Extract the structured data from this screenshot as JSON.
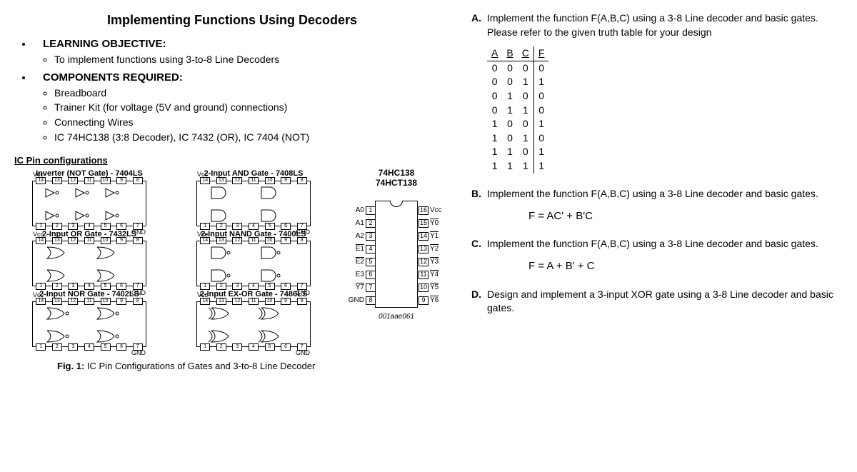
{
  "title": "Implementing Functions Using Decoders",
  "learning": {
    "header": "LEARNING OBJECTIVE:",
    "items": [
      "To implement functions using 3-to-8 Line Decoders"
    ]
  },
  "components": {
    "header": "COMPONENTS REQUIRED:",
    "items": [
      "Breadboard",
      "Trainer Kit (for voltage (5V and ground) connections)",
      "Connecting Wires",
      "IC 74HC138 (3:8 Decoder), IC 7432 (OR), IC 7404 (NOT)"
    ]
  },
  "pincfg": {
    "header": "IC Pin configurations",
    "chips": [
      {
        "label": "Inverter (NOT Gate) - 7404LS"
      },
      {
        "label": "2-Input AND Gate - 7408LS"
      },
      {
        "label": "2-Input OR Gate - 7432LS"
      },
      {
        "label": "2-Input NAND Gate - 7400LS"
      },
      {
        "label": "2-Input NOR Gate - 7402LS"
      },
      {
        "label": "2-Input EX-OR Gate - 7486LS"
      }
    ],
    "vcc": "Vcc",
    "gnd": "GND"
  },
  "decoder": {
    "title1": "74HC138",
    "title2": "74HCT138",
    "left_pins": [
      {
        "lbl": "A0",
        "n": "1"
      },
      {
        "lbl": "A1",
        "n": "2"
      },
      {
        "lbl": "A2",
        "n": "3"
      },
      {
        "lbl": "E1",
        "n": "4",
        "bar": true
      },
      {
        "lbl": "E2",
        "n": "5",
        "bar": true
      },
      {
        "lbl": "E3",
        "n": "6"
      },
      {
        "lbl": "Y7",
        "n": "7",
        "bar": true
      },
      {
        "lbl": "GND",
        "n": "8"
      }
    ],
    "right_pins": [
      {
        "lbl": "Vcc",
        "n": "16"
      },
      {
        "lbl": "Y0",
        "n": "15",
        "bar": true
      },
      {
        "lbl": "Y1",
        "n": "14",
        "bar": true
      },
      {
        "lbl": "Y2",
        "n": "13",
        "bar": true
      },
      {
        "lbl": "Y3",
        "n": "12",
        "bar": true
      },
      {
        "lbl": "Y4",
        "n": "11",
        "bar": true
      },
      {
        "lbl": "Y5",
        "n": "10",
        "bar": true
      },
      {
        "lbl": "Y6",
        "n": "9",
        "bar": true
      }
    ],
    "footer": "001aae061"
  },
  "figure_caption_bold": "Fig. 1:",
  "figure_caption": " IC Pin Configurations of Gates and 3-to-8 Line Decoder",
  "tasks": {
    "A": {
      "text1": "Implement the function F(A,B,C) using a 3-8 Line decoder and basic gates.",
      "text2": "Please refer to the given truth table for your design",
      "truth_header": [
        "A",
        "B",
        "C",
        "F"
      ],
      "truth_rows": [
        [
          "0",
          "0",
          "0",
          "0"
        ],
        [
          "0",
          "0",
          "1",
          "1"
        ],
        [
          "0",
          "1",
          "0",
          "0"
        ],
        [
          "0",
          "1",
          "1",
          "0"
        ],
        [
          "1",
          "0",
          "0",
          "1"
        ],
        [
          "1",
          "0",
          "1",
          "0"
        ],
        [
          "1",
          "1",
          "0",
          "1"
        ],
        [
          "1",
          "1",
          "1",
          "1"
        ]
      ]
    },
    "B": {
      "text": "Implement the function F(A,B,C) using a 3-8 Line decoder and basic gates.",
      "formula": "F = AC' + B'C"
    },
    "C": {
      "text": "Implement the function F(A,B,C) using a 3-8 Line decoder and basic gates.",
      "formula": "F = A + B' + C"
    },
    "D": {
      "text": "Design and implement a 3-input XOR gate using a 3-8 Line decoder and basic gates."
    }
  }
}
